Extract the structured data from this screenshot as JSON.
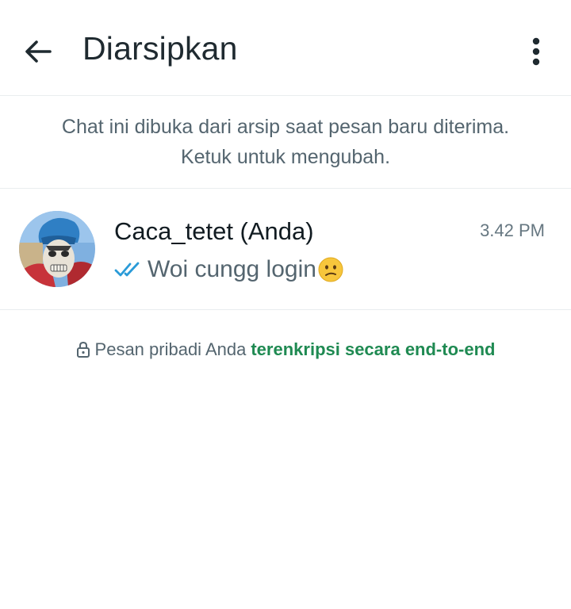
{
  "app_bar": {
    "title": "Diarsipkan",
    "back_icon": "arrow-left-icon",
    "menu_icon": "more-vertical-icon"
  },
  "banner": {
    "line1": "Chat ini dibuka dari arsip saat pesan baru diterima.",
    "line2": "Ketuk untuk mengubah."
  },
  "chats": [
    {
      "name": "Caca_tetet (Anda)",
      "time": "3.42 PM",
      "status_icon": "double-check-icon",
      "message": "Woi cungg login",
      "emoji_icon": "confused-face-emoji"
    }
  ],
  "encryption_notice": {
    "text": "Pesan pribadi Anda",
    "link": "terenkripsi secara end-to-end",
    "icon": "lock-icon"
  },
  "colors": {
    "title": "#1f2a30",
    "secondary_text": "#54656f",
    "time_text": "#667781",
    "read_tick": "#2a9bd8",
    "link_green": "#1f8a52",
    "divider": "#e9edef"
  }
}
